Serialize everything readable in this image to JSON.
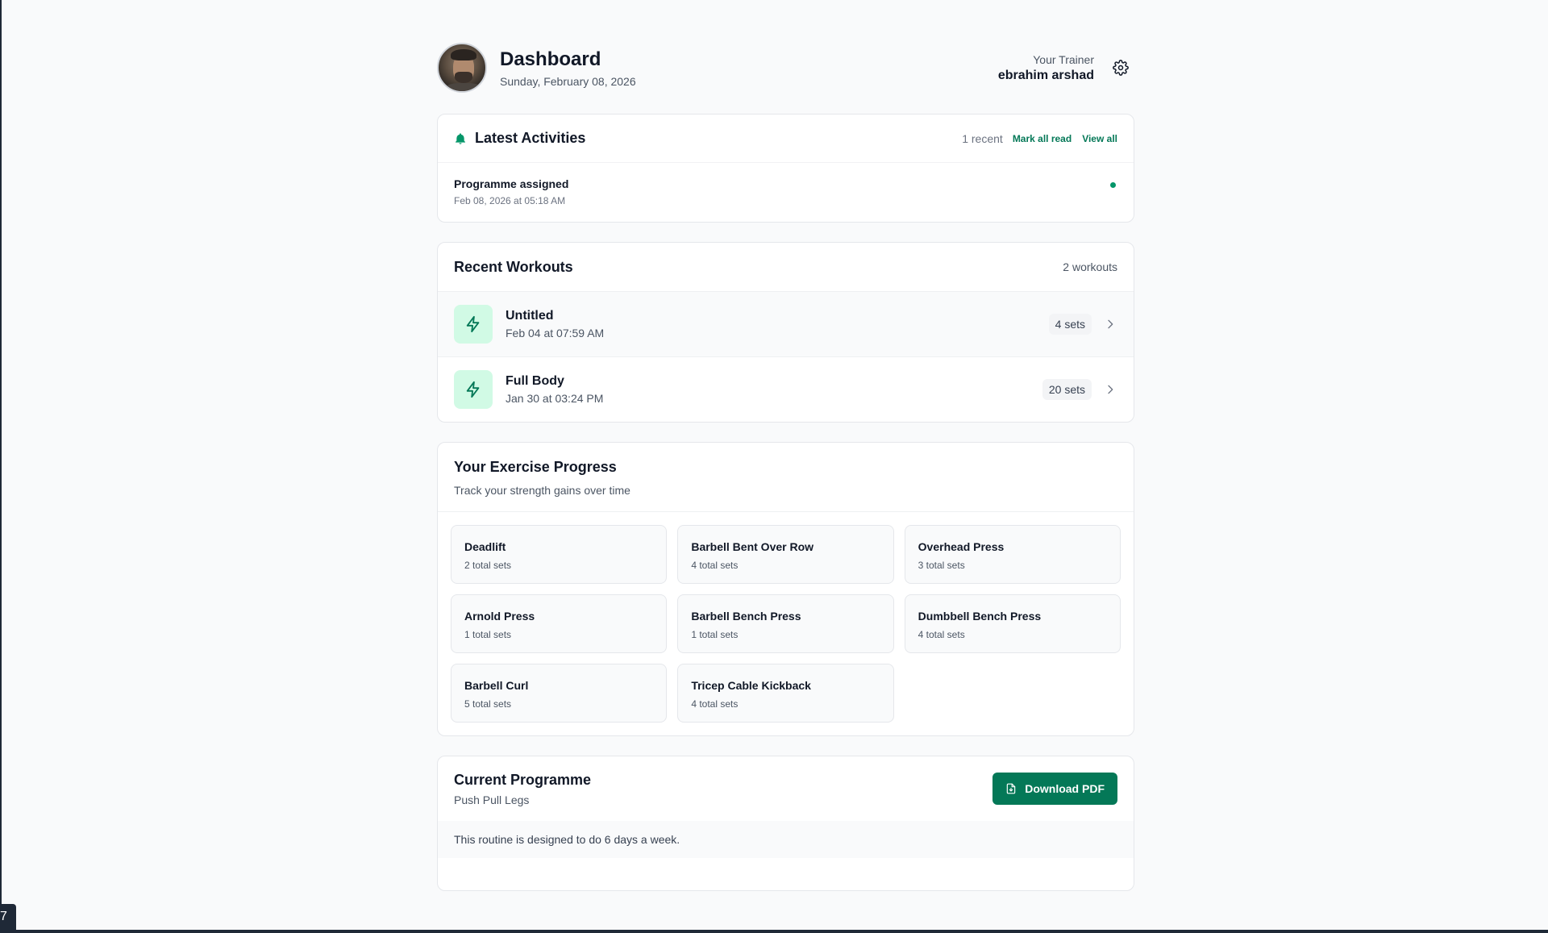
{
  "header": {
    "title": "Dashboard",
    "date": "Sunday, February 08, 2026",
    "trainer_label": "Your Trainer",
    "trainer_name": "ebrahim arshad"
  },
  "activities": {
    "title": "Latest Activities",
    "count_text": "1 recent",
    "mark_all_read": "Mark all read",
    "view_all": "View all",
    "items": [
      {
        "name": "Programme assigned",
        "time": "Feb 08, 2026 at 05:18 AM",
        "unread": true
      }
    ]
  },
  "workouts": {
    "title": "Recent Workouts",
    "count_text": "2 workouts",
    "items": [
      {
        "name": "Untitled",
        "time": "Feb 04 at 07:59 AM",
        "sets": "4 sets"
      },
      {
        "name": "Full Body",
        "time": "Jan 30 at 03:24 PM",
        "sets": "20 sets"
      }
    ]
  },
  "progress": {
    "title": "Your Exercise Progress",
    "subtitle": "Track your strength gains over time",
    "exercises": [
      {
        "name": "Deadlift",
        "sets": "2 total sets"
      },
      {
        "name": "Barbell Bent Over Row",
        "sets": "4 total sets"
      },
      {
        "name": "Overhead Press",
        "sets": "3 total sets"
      },
      {
        "name": "Arnold Press",
        "sets": "1 total sets"
      },
      {
        "name": "Barbell Bench Press",
        "sets": "1 total sets"
      },
      {
        "name": "Dumbbell Bench Press",
        "sets": "4 total sets"
      },
      {
        "name": "Barbell Curl",
        "sets": "5 total sets"
      },
      {
        "name": "Tricep Cable Kickback",
        "sets": "4 total sets"
      }
    ]
  },
  "programme": {
    "title": "Current Programme",
    "name": "Push Pull Legs",
    "download_label": "Download PDF",
    "description": "This routine is designed to do 6 days a week."
  },
  "corner_chip": "7",
  "icons": {
    "settings": "gear-icon",
    "activities": "bell-icon",
    "workout": "lightning-icon",
    "row_action": "chevron-right-icon",
    "download": "file-icon"
  },
  "colors": {
    "accent": "#047857",
    "accent_light": "#d1fae5",
    "unread_dot": "#059669"
  }
}
